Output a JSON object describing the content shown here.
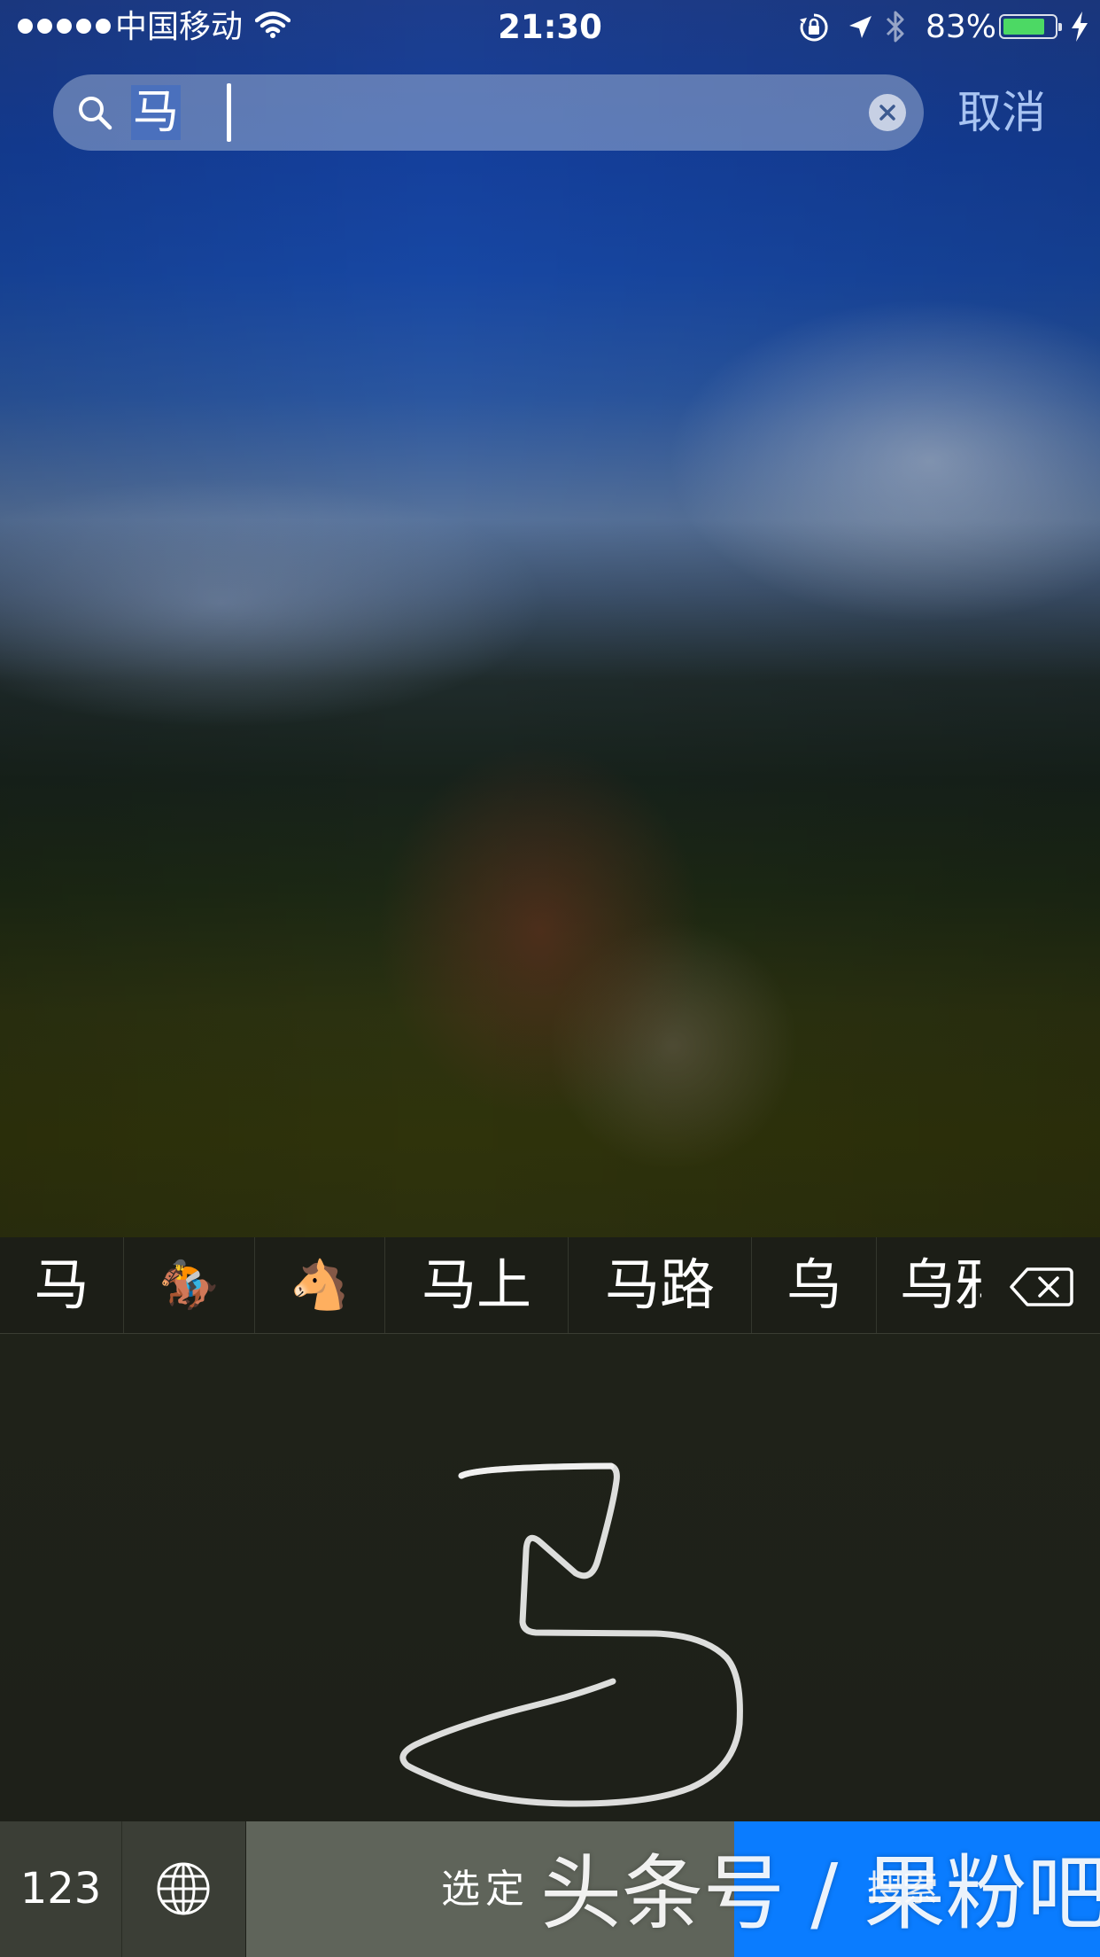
{
  "status_bar": {
    "signal_dots": 5,
    "carrier": "中国移动",
    "time": "21:30",
    "battery_percent": "83%",
    "battery_level": 0.83,
    "battery_color": "#4cd964"
  },
  "search": {
    "query": "马",
    "cancel_label": "取消"
  },
  "candidates": [
    {
      "label": "马"
    },
    {
      "label": "🏇"
    },
    {
      "label": "🐴"
    },
    {
      "label": "马上"
    },
    {
      "label": "马路"
    },
    {
      "label": "乌"
    },
    {
      "label": "乌鸦"
    }
  ],
  "keyboard": {
    "numbers_key": "123",
    "space_label": "选定",
    "search_key_label": "搜索",
    "search_key_color": "#0a7cff"
  },
  "watermark": "头条号 / 果粉吧"
}
